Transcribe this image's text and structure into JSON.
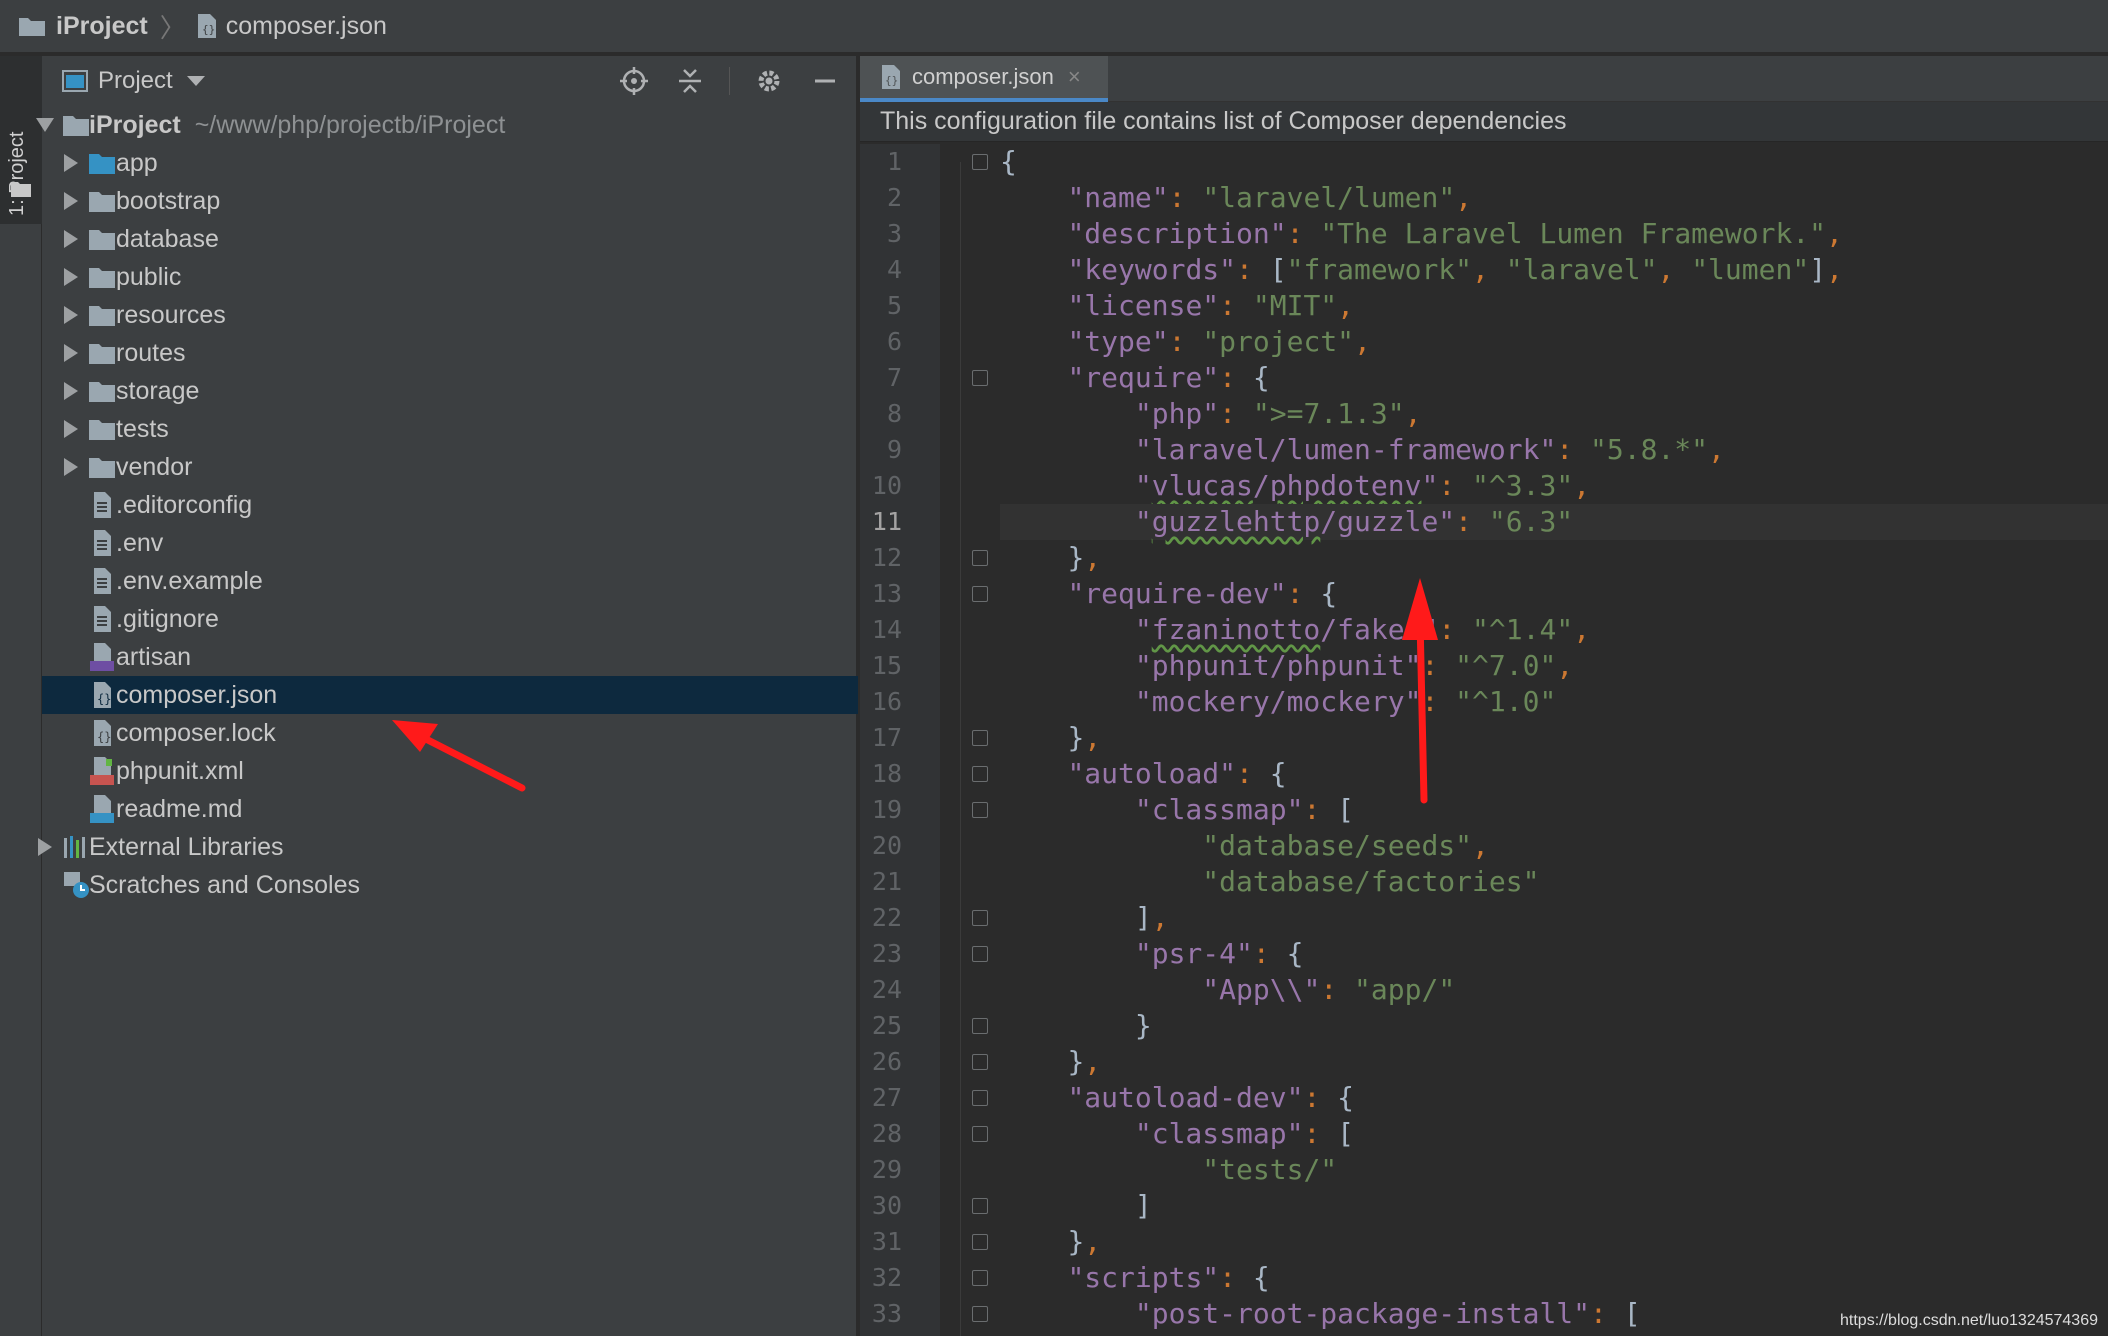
{
  "breadcrumb": {
    "project": "iProject",
    "file": "composer.json"
  },
  "tool_stripe": {
    "label": "1: Project"
  },
  "project_panel": {
    "view_title": "Project",
    "root": {
      "name": "iProject",
      "path": "~/www/php/projectb/iProject"
    },
    "folders": [
      "app",
      "bootstrap",
      "database",
      "public",
      "resources",
      "routes",
      "storage",
      "tests",
      "vendor"
    ],
    "files": [
      ".editorconfig",
      ".env",
      ".env.example",
      ".gitignore",
      "artisan",
      "composer.json",
      "composer.lock",
      "phpunit.xml",
      "readme.md"
    ],
    "selected_file": "composer.json",
    "external_libraries": "External Libraries",
    "scratches": "Scratches and Consoles"
  },
  "editor": {
    "tab_label": "composer.json",
    "tab_close": "×",
    "notice": "This configuration file contains list of Composer dependencies",
    "current_line": 11,
    "line_numbers": [
      "1",
      "2",
      "3",
      "4",
      "5",
      "6",
      "7",
      "8",
      "9",
      "10",
      "11",
      "12",
      "13",
      "14",
      "15",
      "16",
      "17",
      "18",
      "19",
      "20",
      "21",
      "22",
      "23",
      "24",
      "25",
      "26",
      "27",
      "28",
      "29",
      "30",
      "31",
      "32",
      "33"
    ]
  },
  "colors": {
    "key": "#9876aa",
    "string": "#6a8759",
    "punct": "#cc7832",
    "selection": "#0d293e",
    "annotation_arrow": "#ff1a1a"
  },
  "watermark": "https://blog.csdn.net/luo1324574369"
}
